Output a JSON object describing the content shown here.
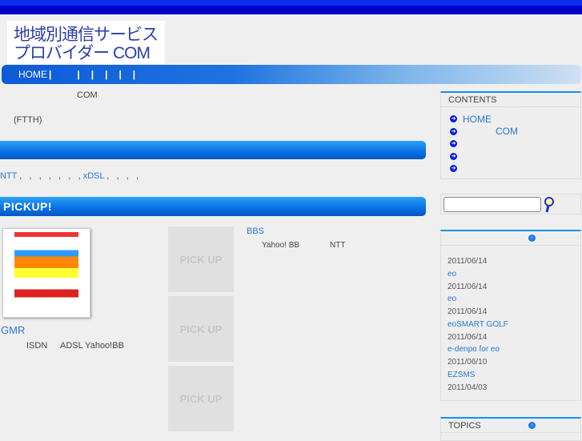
{
  "logo": {
    "line1": "地域別通信サービス",
    "line2": "プロバイダー COM"
  },
  "nav": {
    "home": "HOME",
    "separators": [
      "|",
      "|",
      "|",
      "|",
      "|",
      "|"
    ]
  },
  "intro": {
    "line1": "COM",
    "line2": "(FTTH)"
  },
  "providers": {
    "ntt": "NTT",
    "commas1": ",   ,   ,   ,   ,   ,   ,",
    "xdsl": "xDSL",
    "commas2": ",   ,   ,   ,"
  },
  "pickup": {
    "title": "PICKUP!",
    "featured_title": "GMR",
    "featured_desc": [
      "ISDN",
      "ADSL Yahoo!BB"
    ],
    "placeholder": "PICK UP",
    "side_title": "BBS",
    "side_desc": [
      "Yahoo! BB",
      "NTT"
    ]
  },
  "contents": {
    "title": "CONTENTS",
    "items": [
      "HOME",
      "COM",
      "",
      "",
      ""
    ]
  },
  "search": {
    "value": ""
  },
  "news": {
    "items": [
      {
        "date": "2011/06/14",
        "title": "eo"
      },
      {
        "date": "2011/06/14",
        "title": "eo"
      },
      {
        "date": "2011/06/14",
        "title": "eoSMART GOLF"
      },
      {
        "date": "2011/06/14",
        "title": "e-denpo for eo"
      },
      {
        "date": "2011/06/10",
        "title": "EZSMS"
      },
      {
        "date": "2011/04/03",
        "title": ""
      }
    ]
  },
  "topics": {
    "title": "TOPICS"
  },
  "colors": {
    "accent": "#1591ea",
    "link": "#2a78d0",
    "topbar": "#0000c8"
  }
}
